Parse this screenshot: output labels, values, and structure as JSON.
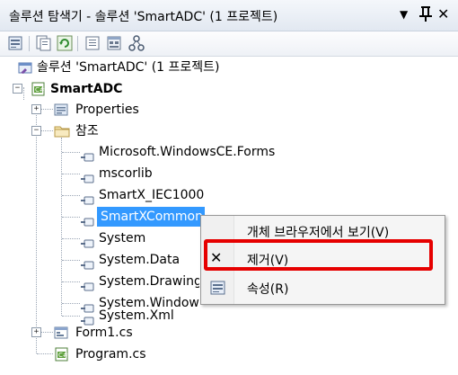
{
  "window": {
    "title": "솔루션 탐색기 - 솔루션 'SmartADC' (1 프로젝트)",
    "dropdown_glyph": "▼",
    "pin_glyph": "ᵖ",
    "close_glyph": "✕"
  },
  "toolbar": {
    "buttons": [
      "properties-icon",
      "show-all-files-icon",
      "refresh-icon",
      "view-code-icon",
      "view-designer-icon",
      "class-diagram-icon"
    ]
  },
  "tree": {
    "solution": "솔루션 'SmartADC' (1 프로젝트)",
    "project": "SmartADC",
    "properties": "Properties",
    "references_folder": "참조",
    "references": [
      "Microsoft.WindowsCE.Forms",
      "mscorlib",
      "SmartX_IEC1000",
      "SmartXCommon",
      "System",
      "System.Data",
      "System.Drawing",
      "System.Windows.Forms",
      "System.Xml"
    ],
    "selected_reference": "SmartXCommon",
    "form1": "Form1.cs",
    "program": "Program.cs"
  },
  "context_menu": {
    "items": [
      {
        "label": "개체 브라우저에서 보기(V)",
        "icon": ""
      },
      {
        "label": "제거(V)",
        "icon": "remove-x-icon",
        "glyph": "✕"
      },
      {
        "label": "속성(R)",
        "icon": "properties-icon"
      }
    ],
    "highlighted_index": 1
  },
  "colors": {
    "selection": "#3399ff",
    "highlight_box": "#e60000"
  }
}
